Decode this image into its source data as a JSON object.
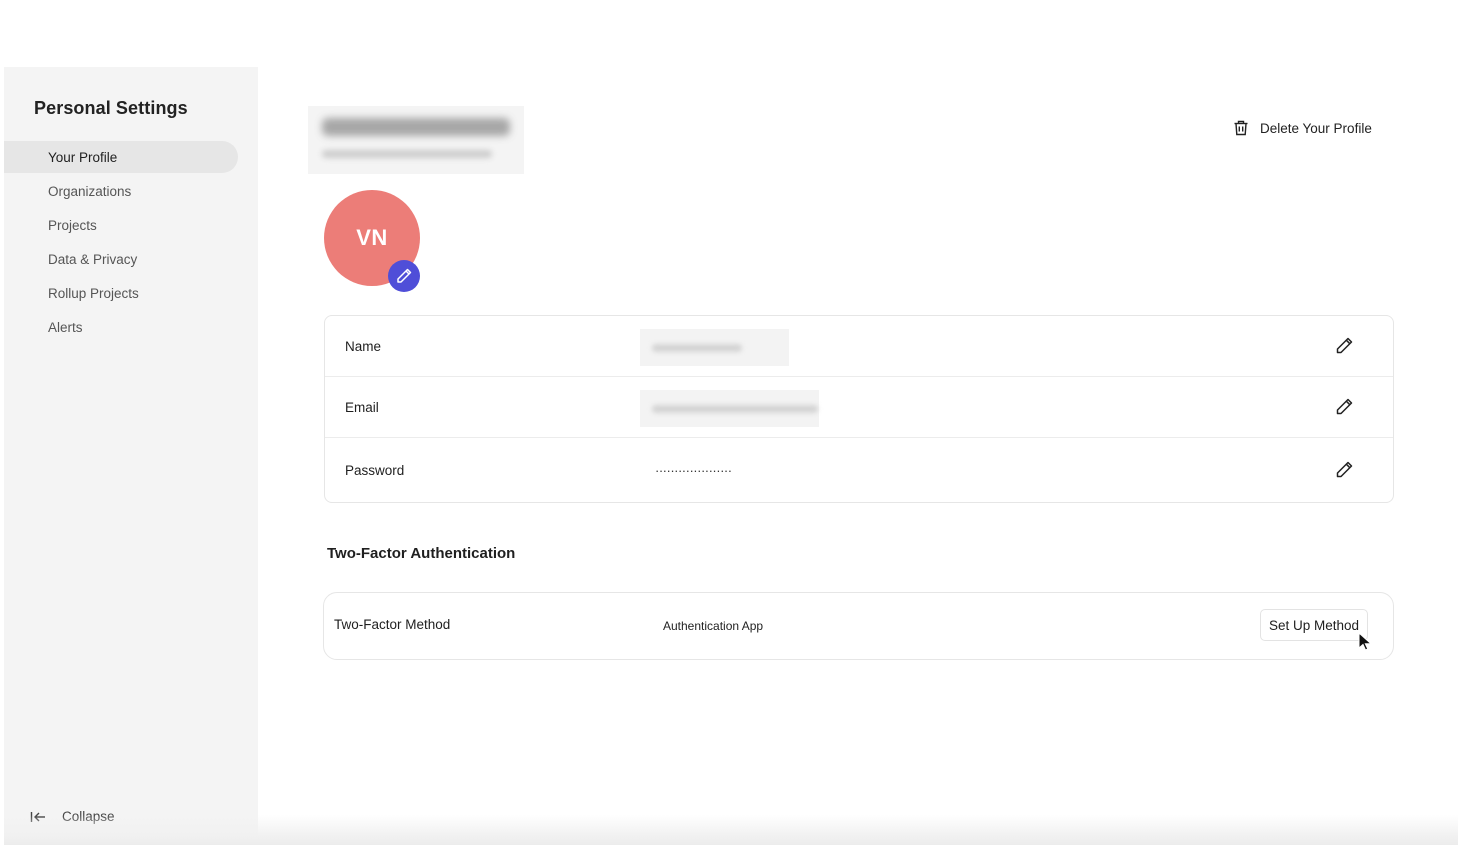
{
  "sidebar": {
    "title": "Personal Settings",
    "items": [
      {
        "label": "Your Profile",
        "active": true
      },
      {
        "label": "Organizations",
        "active": false
      },
      {
        "label": "Projects",
        "active": false
      },
      {
        "label": "Data & Privacy",
        "active": false
      },
      {
        "label": "Rollup Projects",
        "active": false
      },
      {
        "label": "Alerts",
        "active": false
      }
    ],
    "collapse_label": "Collapse",
    "collapse_icon": "collapse-left-icon"
  },
  "header": {
    "name_redacted": true,
    "email_redacted": true,
    "delete_label": "Delete Your Profile",
    "delete_icon": "trash-icon"
  },
  "avatar": {
    "initials": "VN",
    "color": "#ec7d78",
    "edit_badge_color": "#4f4ed8",
    "edit_icon": "pencil-icon"
  },
  "profile_fields": [
    {
      "label": "Name",
      "value_redacted": true,
      "edit_icon": "pencil-icon"
    },
    {
      "label": "Email",
      "value_redacted": true,
      "edit_icon": "pencil-icon"
    },
    {
      "label": "Password",
      "value": "····················",
      "edit_icon": "pencil-icon"
    }
  ],
  "two_factor": {
    "section_title": "Two-Factor Authentication",
    "method_label": "Two-Factor Method",
    "method_value": "Authentication App",
    "setup_button": "Set Up Method"
  }
}
